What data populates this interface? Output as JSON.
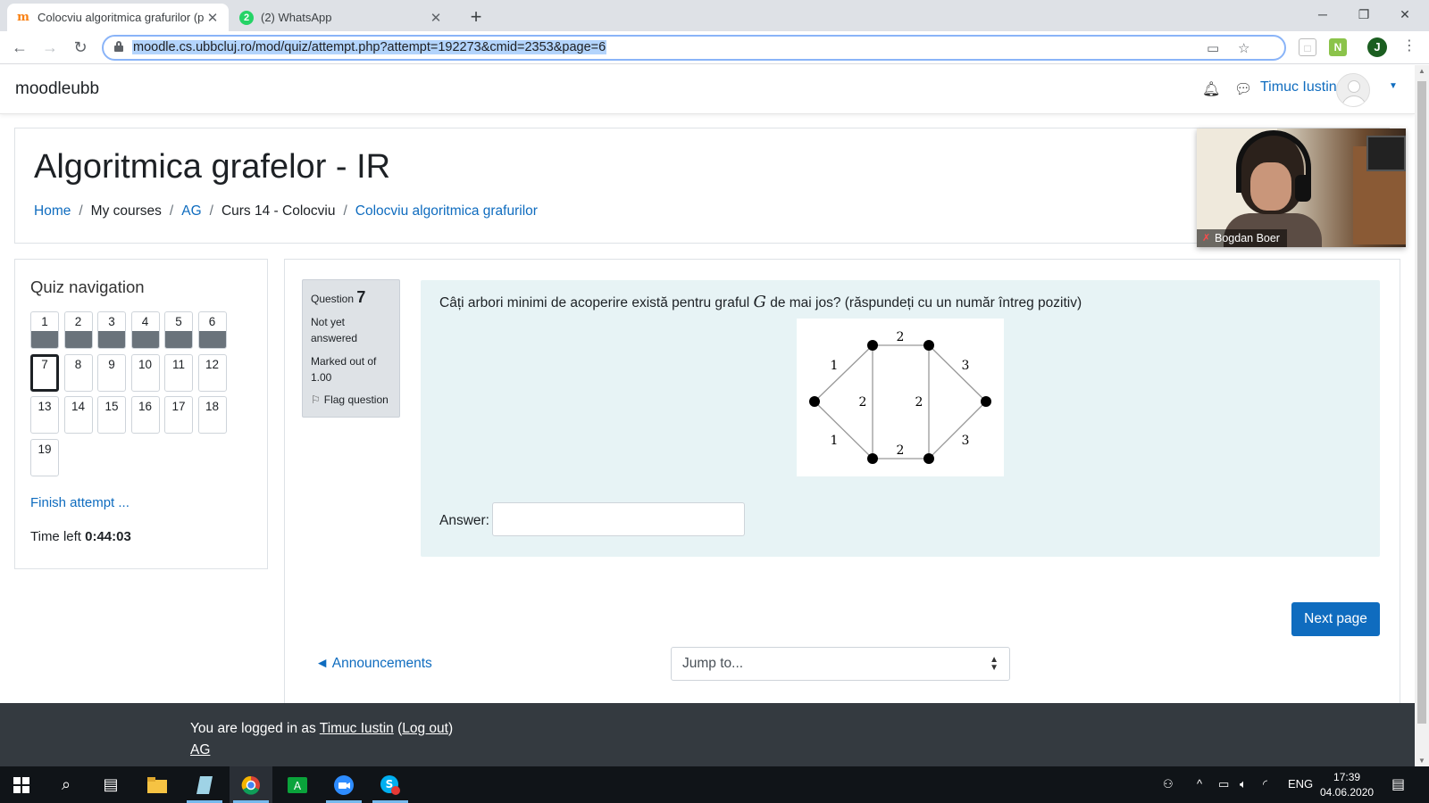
{
  "browser": {
    "tabs": [
      {
        "title": "Colocviu algoritmica grafurilor (p",
        "favicon": "moodle-icon"
      },
      {
        "title": "(2) WhatsApp",
        "favicon": "whatsapp-icon",
        "badge": "2"
      }
    ],
    "url": "moodle.cs.ubbcluj.ro/mod/quiz/attempt.php?attempt=192273&cmid=2353&page=6",
    "profile_initial": "J"
  },
  "navbar": {
    "brand": "moodleubb",
    "user_name": "Timuc Iustin"
  },
  "header": {
    "title": "Algoritmica grafelor - IR",
    "breadcrumb": [
      {
        "label": "Home",
        "link": true
      },
      {
        "label": "My courses",
        "link": false
      },
      {
        "label": "AG",
        "link": true
      },
      {
        "label": "Curs 14 - Colocviu",
        "link": false
      },
      {
        "label": "Colocviu algoritmica grafurilor",
        "link": true
      }
    ]
  },
  "video": {
    "participant_name": "Bogdan Boer"
  },
  "quiz_nav": {
    "title": "Quiz navigation",
    "questions": [
      {
        "n": "1",
        "state": "answered"
      },
      {
        "n": "2",
        "state": "answered"
      },
      {
        "n": "3",
        "state": "answered"
      },
      {
        "n": "4",
        "state": "answered"
      },
      {
        "n": "5",
        "state": "answered"
      },
      {
        "n": "6",
        "state": "answered"
      },
      {
        "n": "7",
        "state": "current"
      },
      {
        "n": "8",
        "state": "unanswered"
      },
      {
        "n": "9",
        "state": "unanswered"
      },
      {
        "n": "10",
        "state": "unanswered"
      },
      {
        "n": "11",
        "state": "unanswered"
      },
      {
        "n": "12",
        "state": "unanswered"
      },
      {
        "n": "13",
        "state": "unanswered"
      },
      {
        "n": "14",
        "state": "unanswered"
      },
      {
        "n": "15",
        "state": "unanswered"
      },
      {
        "n": "16",
        "state": "unanswered"
      },
      {
        "n": "17",
        "state": "unanswered"
      },
      {
        "n": "18",
        "state": "unanswered"
      },
      {
        "n": "19",
        "state": "unanswered"
      }
    ],
    "finish_label": "Finish attempt ...",
    "time_left_label": "Time left",
    "time_left_value": "0:44:03"
  },
  "question": {
    "label": "Question",
    "number": "7",
    "state": "Not yet answered",
    "grade": "Marked out of 1.00",
    "flag_label": "Flag question",
    "text_before": "Câți arbori minimi de acoperire există pentru graful",
    "text_math": "G",
    "text_after": "de mai jos? (răspundeți cu un număr întreg pozitiv)",
    "answer_label": "Answer:",
    "answer_value": "",
    "graph": {
      "edge_weights": [
        "2",
        "1",
        "3",
        "2",
        "2",
        "1",
        "2",
        "3"
      ]
    }
  },
  "actions": {
    "next_label": "Next page",
    "prev_link": "◄ Announcements",
    "jump_placeholder": "Jump to..."
  },
  "footer": {
    "logged_in_prefix": "You are logged in as",
    "user_link": "Timuc Iustin",
    "logout": "Log out",
    "course": "AG"
  },
  "taskbar": {
    "lang": "ENG",
    "time": "17:39",
    "date": "04.06.2020"
  }
}
